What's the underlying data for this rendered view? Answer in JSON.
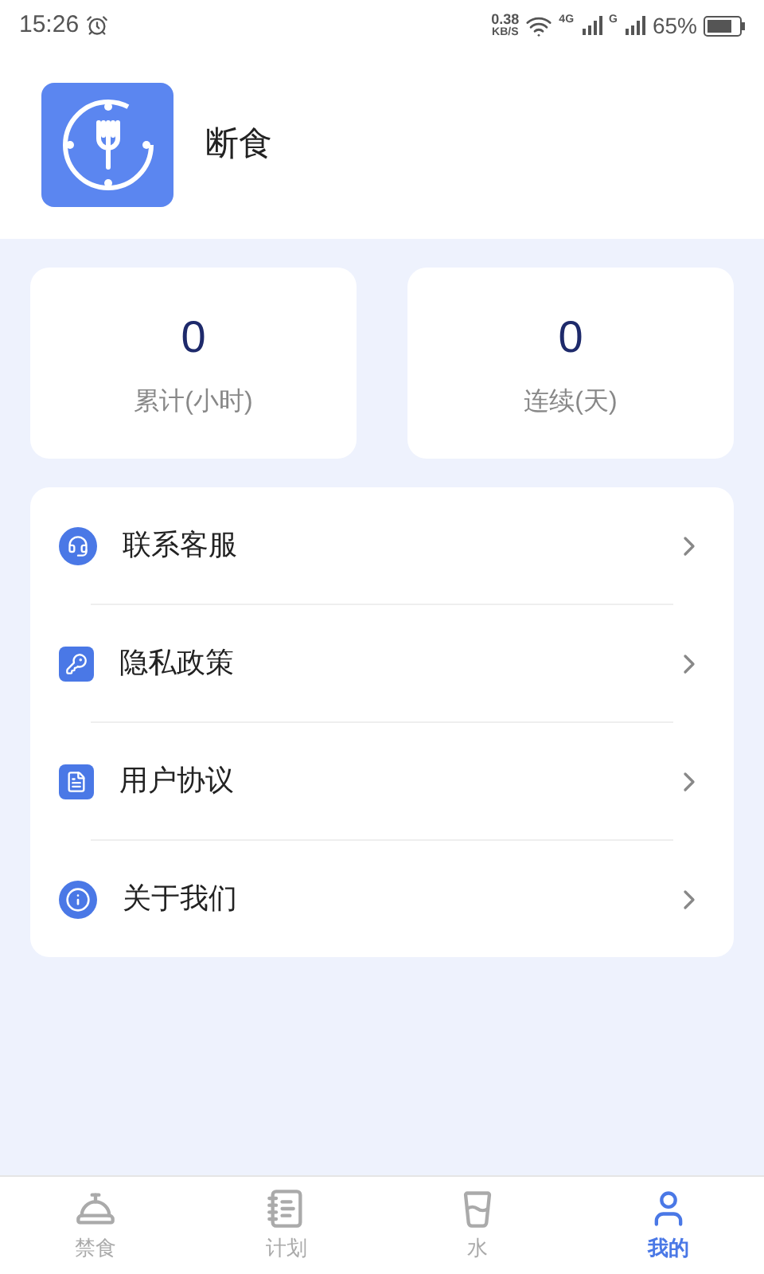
{
  "status_bar": {
    "time": "15:26",
    "speed_value": "0.38",
    "speed_unit": "KB/S",
    "network_1": "4G",
    "network_2": "G",
    "battery": "65%"
  },
  "profile": {
    "name": "断食"
  },
  "stats": [
    {
      "value": "0",
      "label": "累计(小时)"
    },
    {
      "value": "0",
      "label": "连续(天)"
    }
  ],
  "menu": [
    {
      "kind": "service",
      "label": "联系客服"
    },
    {
      "kind": "privacy",
      "label": "隐私政策"
    },
    {
      "kind": "agreement",
      "label": "用户协议"
    },
    {
      "kind": "about",
      "label": "关于我们"
    }
  ],
  "tabs": [
    {
      "kind": "fasting",
      "label": "禁食",
      "selected": false
    },
    {
      "kind": "plan",
      "label": "计划",
      "selected": false
    },
    {
      "kind": "water",
      "label": "水",
      "selected": false
    },
    {
      "kind": "mine",
      "label": "我的",
      "selected": true
    }
  ]
}
